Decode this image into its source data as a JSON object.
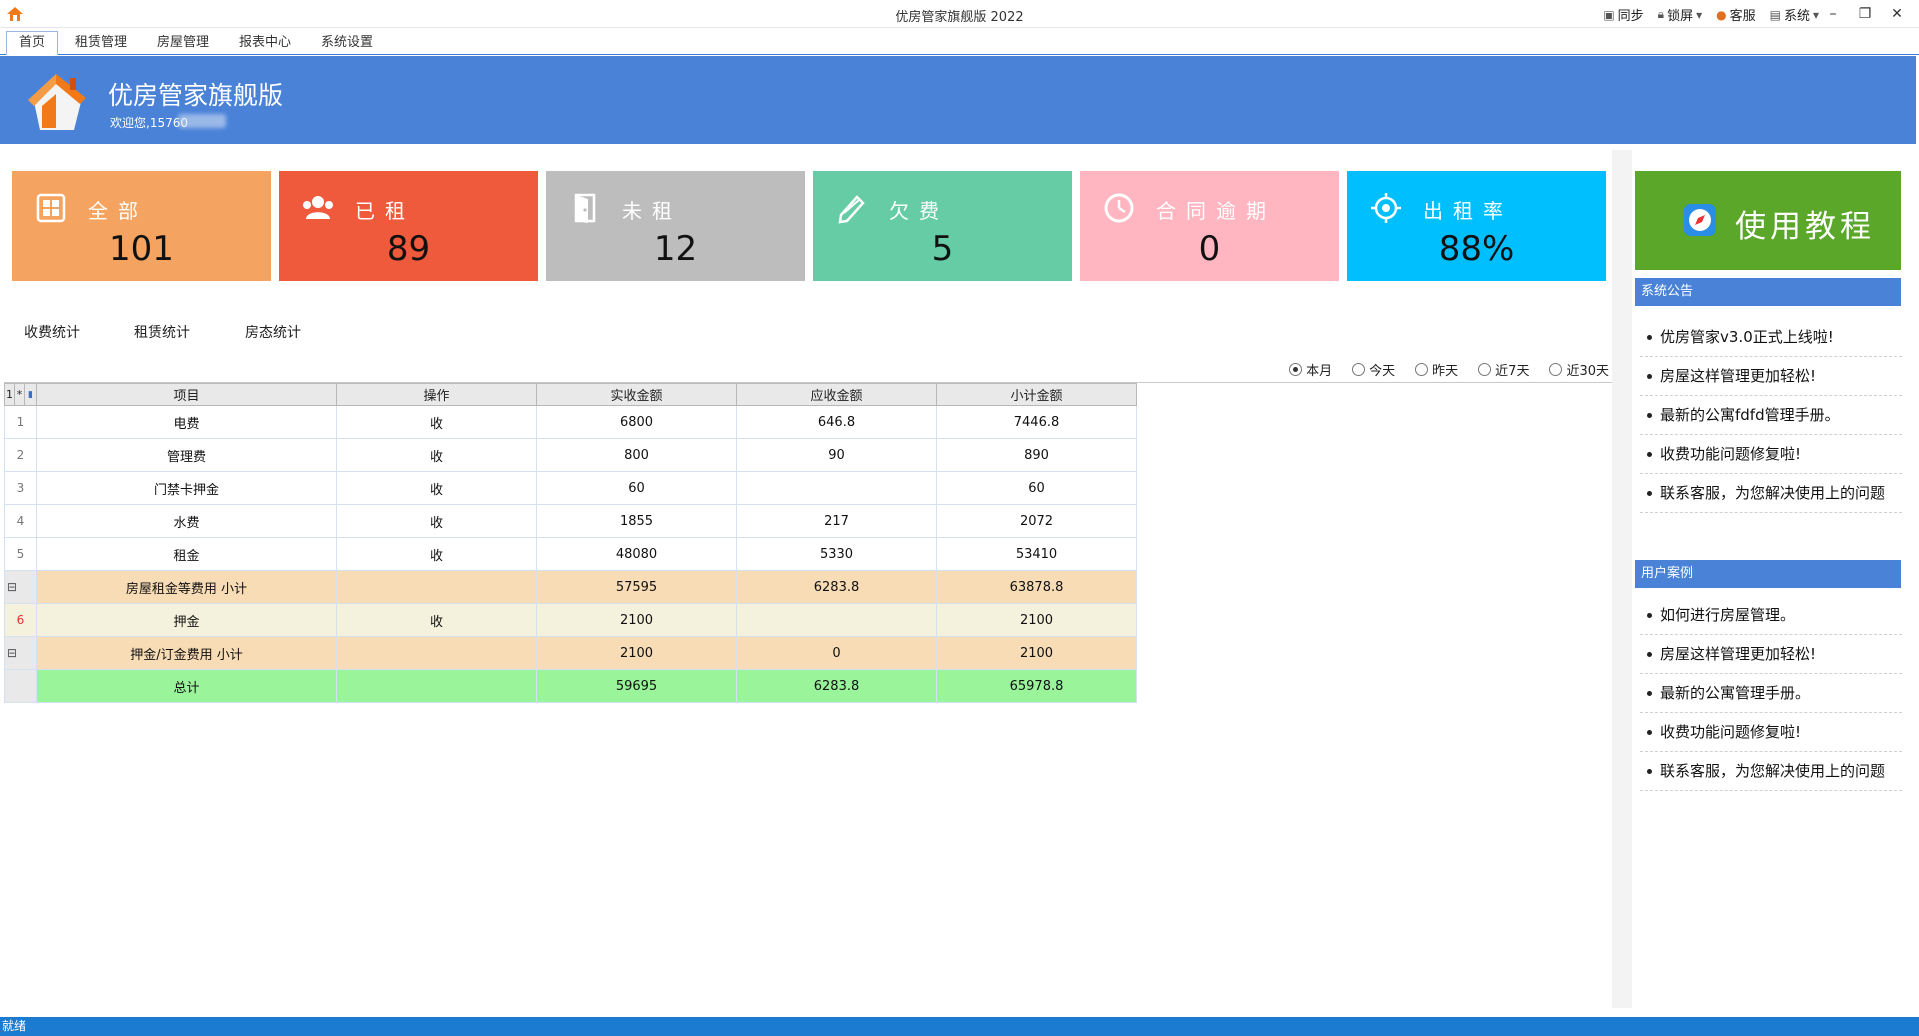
{
  "window": {
    "title": "优房管家旗舰版 2022"
  },
  "toolbar": {
    "sync": "同步",
    "lock": "锁屏",
    "service": "客服",
    "system": "系统"
  },
  "menu": {
    "tabs": [
      "首页",
      "租赁管理",
      "房屋管理",
      "报表中心",
      "系统设置"
    ],
    "active": "首页"
  },
  "banner": {
    "app_name": "优房管家旗舰版",
    "welcome": "欢迎您,15760"
  },
  "stats": [
    {
      "label": "全部",
      "value": "101",
      "color": "#f4a460",
      "icon": "grid-icon"
    },
    {
      "label": "已租",
      "value": "89",
      "color": "#ef5a3c",
      "icon": "users-icon"
    },
    {
      "label": "未租",
      "value": "12",
      "color": "#bdbdbd",
      "icon": "door-icon"
    },
    {
      "label": "欠费",
      "value": "5",
      "color": "#66cca6",
      "icon": "pen-icon"
    },
    {
      "label": "合同逾期",
      "value": "0",
      "color": "#ffb6c1",
      "icon": "clock-icon"
    },
    {
      "label": "出租率",
      "value": "88%",
      "color": "#00bfff",
      "icon": "target-icon"
    }
  ],
  "tutorial": {
    "label": "使用教程"
  },
  "subtabs": [
    "收费统计",
    "租赁统计",
    "房态统计"
  ],
  "period": {
    "options": [
      "本月",
      "今天",
      "昨天",
      "近7天",
      "近30天"
    ],
    "selected": "本月"
  },
  "grid": {
    "header_corner": [
      "1",
      "*"
    ],
    "columns": [
      "项目",
      "操作",
      "实收金额",
      "应收金额",
      "小计金额"
    ],
    "rows": [
      {
        "rn": "1",
        "type": "normal",
        "cells": [
          "电费",
          "收",
          "6800",
          "646.8",
          "7446.8"
        ]
      },
      {
        "rn": "2",
        "type": "normal",
        "cells": [
          "管理费",
          "收",
          "800",
          "90",
          "890"
        ]
      },
      {
        "rn": "3",
        "type": "normal",
        "cells": [
          "门禁卡押金",
          "收",
          "60",
          "",
          "60"
        ]
      },
      {
        "rn": "4",
        "type": "normal",
        "cells": [
          "水费",
          "收",
          "1855",
          "217",
          "2072"
        ]
      },
      {
        "rn": "5",
        "type": "normal",
        "cells": [
          "租金",
          "收",
          "48080",
          "5330",
          "53410"
        ]
      },
      {
        "rn": "⊟",
        "type": "sub",
        "cells": [
          "房屋租金等费用 小计",
          "",
          "57595",
          "6283.8",
          "63878.8"
        ]
      },
      {
        "rn": "6",
        "type": "dep",
        "cells": [
          "押金",
          "收",
          "2100",
          "",
          "2100"
        ]
      },
      {
        "rn": "⊟",
        "type": "sub",
        "cells": [
          "押金/订金费用 小计",
          "",
          "2100",
          "0",
          "2100"
        ]
      },
      {
        "rn": "",
        "type": "tot",
        "cells": [
          "总计",
          "",
          "59695",
          "6283.8",
          "65978.8"
        ]
      }
    ]
  },
  "announcements": {
    "title": "系统公告",
    "items": [
      "优房管家v3.0正式上线啦!",
      "房屋这样管理更加轻松!",
      "最新的公寓fdfd管理手册。",
      "收费功能问题修复啦!",
      "联系客服，为您解决使用上的问题"
    ]
  },
  "cases": {
    "title": "用户案例",
    "items": [
      "如何进行房屋管理。",
      "房屋这样管理更加轻松!",
      "最新的公寓管理手册。",
      "收费功能问题修复啦!",
      "联系客服，为您解决使用上的问题"
    ]
  },
  "status": {
    "text": "就绪"
  }
}
